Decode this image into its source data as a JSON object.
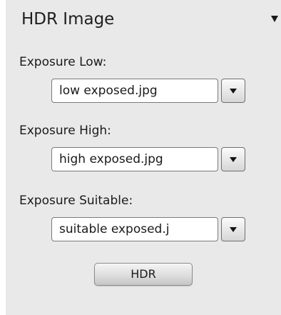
{
  "panel": {
    "title": "HDR Image",
    "collapse_icon": "triangle-down-icon"
  },
  "fields": [
    {
      "label": "Exposure Low:",
      "value": "low exposed.jpg"
    },
    {
      "label": "Exposure High:",
      "value": "high exposed.jpg"
    },
    {
      "label": "Exposure Suitable:",
      "value": "suitable exposed.j"
    }
  ],
  "actions": {
    "hdr_label": "HDR"
  },
  "colors": {
    "panel_background": "#e9e9e9",
    "field_background": "#ffffff",
    "text": "#1a1a1a"
  }
}
